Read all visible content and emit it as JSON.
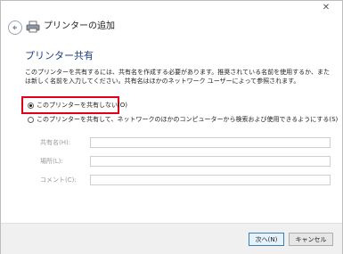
{
  "window": {
    "title": "プリンターの追加",
    "close_glyph": "✕"
  },
  "page": {
    "heading": "プリンター共有",
    "description": "このプリンターを共有するには、共有名を作成する必要があります。推奨されている名前を使用するか、または新しく名前を入力してください。共有名はほかのネットワーク ユーザーによって参照されます。"
  },
  "options": {
    "no_share": {
      "label": "このプリンターを共有しない(O)",
      "selected": true
    },
    "share": {
      "label": "このプリンターを共有して、ネットワークのほかのコンピューターから検索および使用できるようにする(S)",
      "selected": false
    }
  },
  "fields": {
    "share_name": {
      "label": "共有名(H):",
      "value": ""
    },
    "location": {
      "label": "場所(L):",
      "value": ""
    },
    "comment": {
      "label": "コメント(C):",
      "value": ""
    }
  },
  "buttons": {
    "next": "次へ(N)",
    "cancel": "キャンセル"
  },
  "colors": {
    "heading": "#1e3f87",
    "highlight": "#e1001a"
  }
}
